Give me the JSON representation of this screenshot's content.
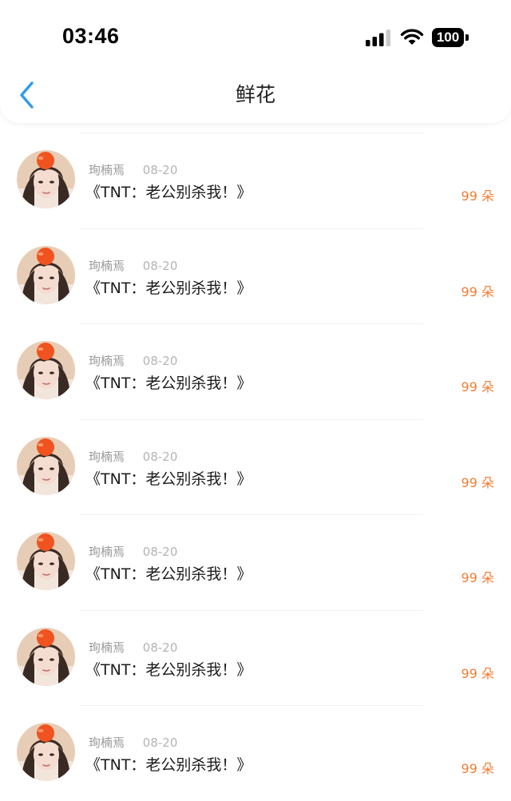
{
  "status_bar": {
    "time": "03:46",
    "battery": "100"
  },
  "nav": {
    "title": "鲜花",
    "back_icon": "chevron-left-icon",
    "accent_color": "#2d9bf0"
  },
  "items": [
    {
      "user": "珣楠焉",
      "date": "08-20",
      "title": "《TNT：老公别杀我！》",
      "count": "99 朵"
    },
    {
      "user": "珣楠焉",
      "date": "08-20",
      "title": "《TNT：老公别杀我！》",
      "count": "99 朵"
    },
    {
      "user": "珣楠焉",
      "date": "08-20",
      "title": "《TNT：老公别杀我！》",
      "count": "99 朵"
    },
    {
      "user": "珣楠焉",
      "date": "08-20",
      "title": "《TNT：老公别杀我！》",
      "count": "99 朵"
    },
    {
      "user": "珣楠焉",
      "date": "08-20",
      "title": "《TNT：老公别杀我！》",
      "count": "99 朵"
    },
    {
      "user": "珣楠焉",
      "date": "08-20",
      "title": "《TNT：老公别杀我！》",
      "count": "99 朵"
    },
    {
      "user": "珣楠焉",
      "date": "08-20",
      "title": "《TNT：老公别杀我！》",
      "count": "99 朵"
    }
  ],
  "colors": {
    "count": "#f07d33",
    "date": "#b4b4b4",
    "user": "#9a9a9a"
  }
}
